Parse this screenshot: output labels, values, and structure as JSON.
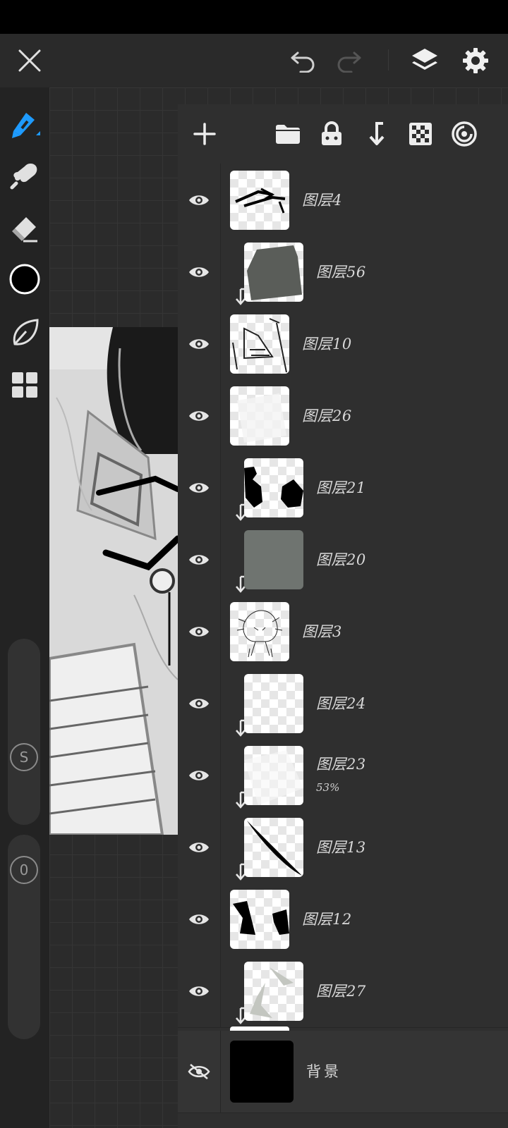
{
  "colors": {
    "accent": "#1e9bff",
    "current_color": "#000000",
    "panel_bg": "#2f2f2f",
    "toolbar_bg": "#232323"
  },
  "topbar": {
    "icons": [
      "close-icon",
      "undo-icon",
      "redo-icon",
      "layers-icon",
      "settings-icon"
    ]
  },
  "tools": [
    "brush-icon",
    "smudge-icon",
    "eraser-icon",
    "color-swatch",
    "selection-icon",
    "gallery-icon"
  ],
  "sliders": {
    "size_label": "S",
    "opacity_label": "0"
  },
  "layer_toolbar": {
    "icons": [
      "add-layer-icon",
      "folder-icon",
      "lock-icon",
      "merge-down-icon",
      "transparency-icon",
      "blend-mode-icon"
    ]
  },
  "layers": [
    {
      "name": "图层4",
      "clipped": false,
      "visible": true
    },
    {
      "name": "图层56",
      "clipped": true,
      "visible": true
    },
    {
      "name": "图层10",
      "clipped": false,
      "visible": true
    },
    {
      "name": "图层26",
      "clipped": false,
      "visible": true
    },
    {
      "name": "图层21",
      "clipped": true,
      "visible": true
    },
    {
      "name": "图层20",
      "clipped": true,
      "visible": true
    },
    {
      "name": "图层3",
      "clipped": false,
      "visible": true
    },
    {
      "name": "图层24",
      "clipped": true,
      "visible": true
    },
    {
      "name": "图层23",
      "clipped": true,
      "visible": true,
      "opacity": "53%"
    },
    {
      "name": "图层13",
      "clipped": true,
      "visible": true
    },
    {
      "name": "图层12",
      "clipped": false,
      "visible": true
    },
    {
      "name": "图层27",
      "clipped": true,
      "visible": true
    }
  ],
  "background_layer": {
    "name": "背景",
    "visible": false
  }
}
